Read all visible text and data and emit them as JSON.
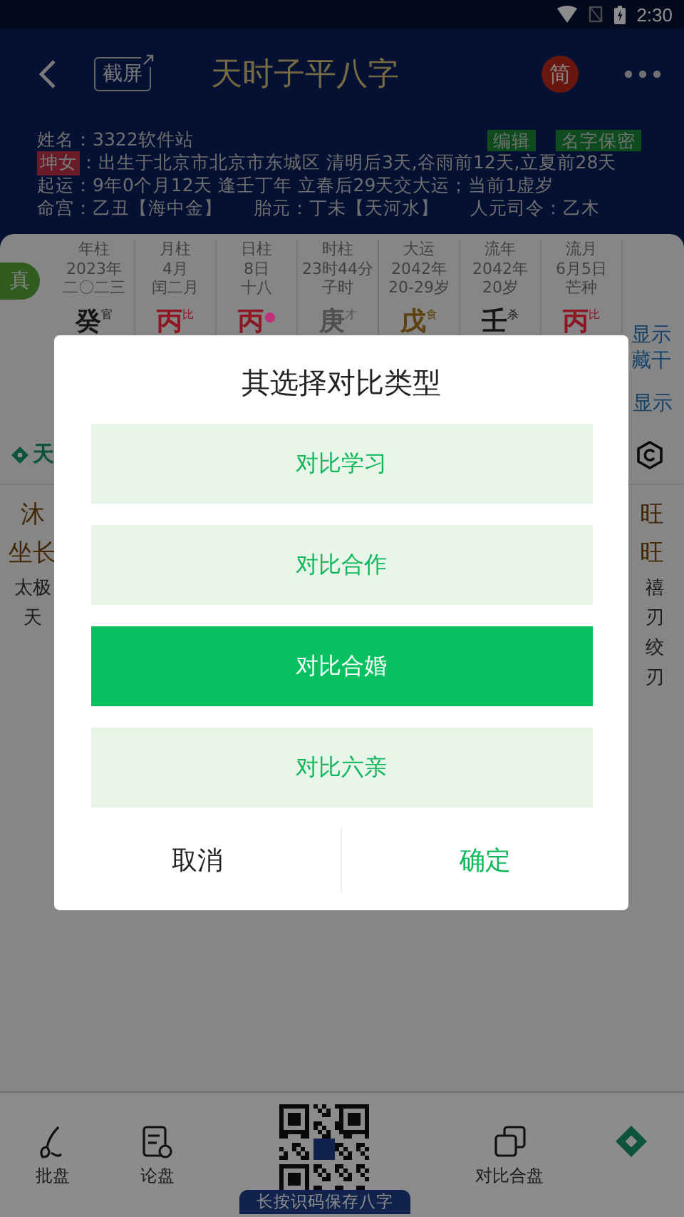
{
  "status_bar": {
    "time": "2:30"
  },
  "header": {
    "title": "天时子平八字",
    "screenshot_button": "截屏",
    "script_badge": "简"
  },
  "profile": {
    "name_line": "姓名：3322软件站",
    "actions": [
      "编辑",
      "名字保密"
    ],
    "gender_tag": "坤女",
    "birth_line": "：出生于北京市北京市东城区 清明后3天,谷雨前12天,立夏前28天",
    "luck_line": "起运：9年0个月12天 逢壬丁年 立春后29天交大运；当前1虚岁",
    "palace_items": [
      "命宫：乙丑【海中金】",
      "胎元：丁未【天河水】",
      "人元司令：乙木"
    ]
  },
  "chart": {
    "true_badge": "真",
    "pillars": [
      {
        "label": "年柱",
        "line2": "2023年",
        "line3": "二〇二三",
        "stem": "癸",
        "god": "官",
        "color": "#161616"
      },
      {
        "label": "月柱",
        "line2": "4月",
        "line3": "闰二月",
        "stem": "丙",
        "god": "比",
        "color": "#8c1622"
      },
      {
        "label": "日柱",
        "line2": "8日",
        "line3": "十八",
        "stem": "丙",
        "marker": true,
        "color": "#8c1622"
      },
      {
        "label": "时柱",
        "line2": "23时44分",
        "line3": "子时",
        "stem": "庚",
        "god": "才",
        "color": "#505050"
      },
      {
        "label": "大运",
        "line2": "2042年",
        "line3": "20-29岁",
        "stem": "戊",
        "god": "食",
        "color": "#5e4210"
      },
      {
        "label": "流年",
        "line2": "2042年",
        "line3": "20岁",
        "stem": "壬",
        "god": "杀",
        "color": "#161616"
      },
      {
        "label": "流月",
        "line2": "6月5日",
        "line3": "芒种",
        "stem": "丙",
        "god": "比",
        "color": "#8c1622"
      }
    ],
    "side_links": [
      "显示",
      "藏干"
    ],
    "side_link_lower": "显示"
  },
  "section": {
    "tab_label": "天",
    "left_lines": [
      "沐",
      "坐长",
      "太极",
      "天"
    ],
    "right_lines": [
      "旺",
      "旺",
      "禧",
      "刃",
      "绞",
      "刃"
    ]
  },
  "bottom_nav": [
    {
      "kind": "brush",
      "label": "批盘"
    },
    {
      "kind": "note",
      "label": "论盘"
    },
    {
      "kind": "qr",
      "label": "长按识码保存八字"
    },
    {
      "kind": "stack",
      "label": "对比合盘"
    },
    {
      "kind": "diamond"
    }
  ],
  "dialog": {
    "title": "其选择对比类型",
    "options": [
      {
        "label": "对比学习",
        "selected": false
      },
      {
        "label": "对比合作",
        "selected": false
      },
      {
        "label": "对比合婚",
        "selected": true
      },
      {
        "label": "对比六亲",
        "selected": false
      }
    ],
    "cancel": "取消",
    "confirm": "确定"
  }
}
